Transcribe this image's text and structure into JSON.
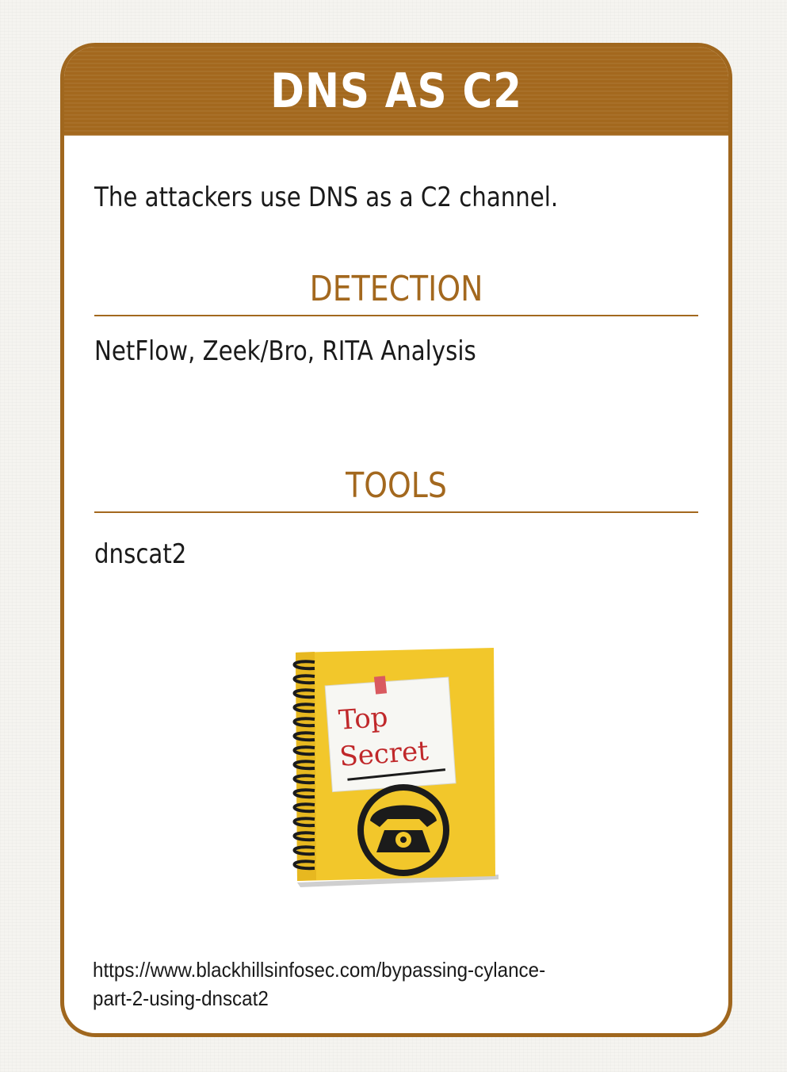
{
  "card": {
    "title": "DNS AS C2",
    "description": "The attackers use DNS as a C2 channel.",
    "sections": [
      {
        "heading": "DETECTION",
        "body": "NetFlow, Zeek/Bro, RITA Analysis"
      },
      {
        "heading": "TOOLS",
        "body": "dnscat2"
      }
    ],
    "illustration": {
      "icon": "top-secret-notebook-telephone-icon",
      "note_text_line1": "Top",
      "note_text_line2": "Secret"
    },
    "reference": {
      "line1": "https://www.blackhillsinfosec.com/bypassing-cylance-",
      "line2": "part-2-using-dnscat2"
    }
  },
  "colors": {
    "accent": "#a3681e",
    "notebook_yellow": "#f2c72b",
    "stamp_red": "#c0282a"
  }
}
